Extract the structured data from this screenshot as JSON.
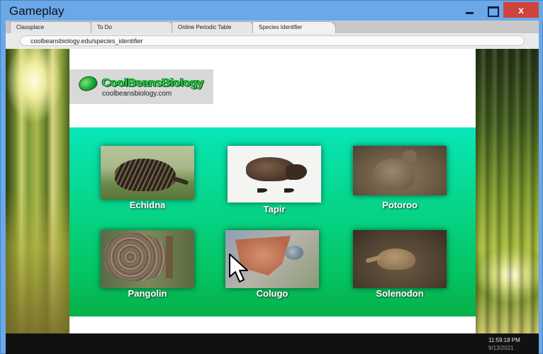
{
  "window": {
    "title": "Gameplay",
    "close_label": "x"
  },
  "tabs": [
    {
      "label": "Classplace"
    },
    {
      "label": "To Do"
    },
    {
      "label": "Online Periodic Table"
    },
    {
      "label": "Species Identifier"
    }
  ],
  "address_bar": {
    "url": "coolbeansbiology.edu/species_identifier"
  },
  "logo": {
    "title": "CoolBeansBiology",
    "subtitle": "coolbeansbiology.com"
  },
  "species": [
    {
      "name": "Echidna",
      "icon": "echidna-photo"
    },
    {
      "name": "Tapir",
      "icon": "tapir-photo"
    },
    {
      "name": "Potoroo",
      "icon": "potoroo-photo"
    },
    {
      "name": "Pangolin",
      "icon": "pangolin-photo"
    },
    {
      "name": "Colugo",
      "icon": "colugo-photo"
    },
    {
      "name": "Solenodon",
      "icon": "solenodon-photo"
    }
  ],
  "clock": {
    "time": "11:59:18 PM",
    "date": "9/13/2021"
  },
  "colors": {
    "titlebar": "#6aa8e8",
    "close_button": "#d0433a",
    "panel_top": "#08e6b8",
    "panel_bottom": "#07b04a"
  }
}
